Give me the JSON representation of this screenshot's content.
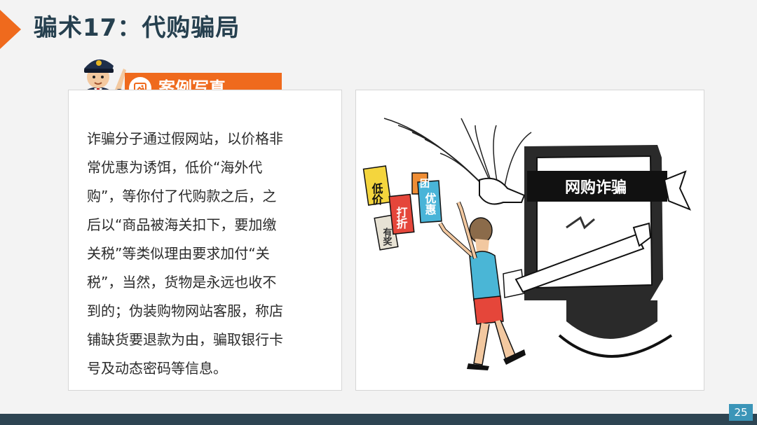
{
  "slide": {
    "title": "骗术17：代购骗局",
    "page_number": "25"
  },
  "section": {
    "label": "案例写真",
    "icon": "picture-icon"
  },
  "case_text": [
    "诈骗分子通过假网站，以价格非",
    "常优惠为诱饵，低价“海外代",
    "购”，等你付了代购款之后，之",
    "后以“商品被海关扣下，要加缴",
    "关税”等类似理由要求加付“关",
    "税”，当然，货物是永远也收不",
    "到的；伪装购物网站客服，称店",
    "铺缺货要退款为由，骗取银行卡",
    "号及动态密码等信息。"
  ],
  "illustration": {
    "screen_label": "网购诈骗",
    "tags": {
      "low_price": "低价",
      "discount": "打折",
      "group": "团",
      "offer": "优惠",
      "prize": "有奖"
    }
  },
  "colors": {
    "title": "#26404f",
    "accent_orange": "#ef6a1d",
    "bar": "#2d4452",
    "page_badge": "#3b95b8"
  }
}
